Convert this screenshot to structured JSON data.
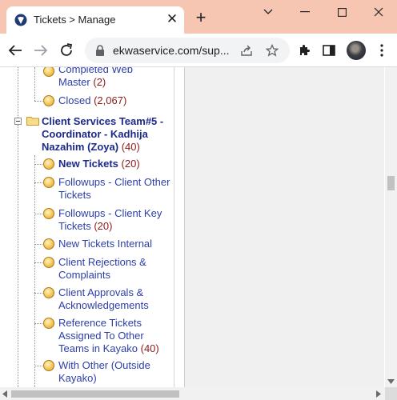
{
  "browser": {
    "tab_title": "Tickets > Manage",
    "url": "ekwaservice.com/sup..."
  },
  "tree": {
    "completed_web_master": {
      "label_line1": "Completed Web",
      "label_line2": "Master",
      "count": "(2)"
    },
    "closed": {
      "label": "Closed",
      "count": "(2,067)"
    },
    "team": {
      "line1": "Client Services Team#5 -",
      "line2": "Coordinator - Kadhija",
      "line3": "Nazahim (Zoya)",
      "count": "(40)"
    },
    "items": [
      {
        "line1": "New Tickets",
        "count": "(20)",
        "bold": true
      },
      {
        "line1": "Followups - Client Other",
        "line2": "Tickets"
      },
      {
        "line1": "Followups - Client Key",
        "line2": "Tickets",
        "count": "(20)"
      },
      {
        "line1": "New Tickets Internal"
      },
      {
        "line1": "Client Rejections &",
        "line2": "Complaints"
      },
      {
        "line1": "Client Approvals &",
        "line2": "Acknowledgements"
      },
      {
        "line1": "Reference Tickets",
        "line2": "Assigned To Other",
        "line3": "Teams in Kayako",
        "count": "(40)"
      },
      {
        "line1": "With Other (Outside",
        "line2": "Kayako)"
      }
    ]
  },
  "colors": {
    "titlebar": "#f6c6b3",
    "link": "#2c3ea8",
    "count": "#8b1a1a"
  },
  "icons": [
    "chrome-logo-icon",
    "close-icon",
    "plus-icon",
    "minimize-icon",
    "maximize-icon",
    "close-window-icon",
    "back-icon",
    "forward-icon",
    "reload-icon",
    "lock-icon",
    "share-icon",
    "star-icon",
    "extensions-icon",
    "side-panel-icon",
    "folder-icon",
    "ticket-bullet-icon"
  ]
}
